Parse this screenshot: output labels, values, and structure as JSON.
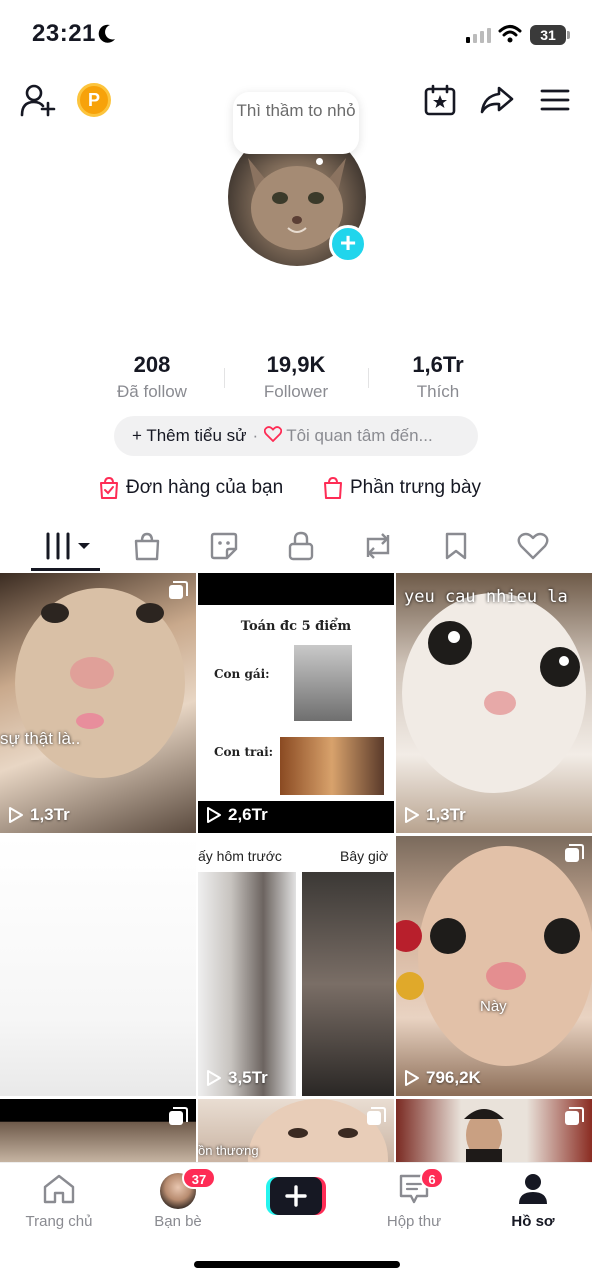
{
  "status_bar": {
    "time": "23:21",
    "battery": "31"
  },
  "header": {
    "coin_letter": "P"
  },
  "profile": {
    "note_bubble": "Thì thầm to nhỏ",
    "stats": [
      {
        "value": "208",
        "label": "Đã follow"
      },
      {
        "value": "19,9K",
        "label": "Follower"
      },
      {
        "value": "1,6Tr",
        "label": "Thích"
      }
    ],
    "bio": {
      "add_label": "+ Thêm tiểu sử",
      "separator": "·",
      "interest_label": "Tôi quan tâm đến..."
    },
    "links": {
      "orders": "Đơn hàng của bạn",
      "showcase": "Phần trưng bày"
    }
  },
  "tabs": [
    "videos-grid",
    "shop",
    "sticker",
    "private",
    "repost",
    "favorites",
    "liked"
  ],
  "grid": [
    {
      "views": "1,3Tr",
      "caption": "sự thật là..",
      "multi": true
    },
    {
      "views": "2,6Tr",
      "caption_title": "Toán đc 5 điểm",
      "label_a": "Con gái:",
      "label_b": "Con trai:",
      "multi": false
    },
    {
      "views": "1,3Tr",
      "caption": "yeu cau nhieu la",
      "multi": false
    },
    {
      "views": "",
      "caption": "",
      "multi": false
    },
    {
      "views": "3,5Tr",
      "caption_left": "ấy hôm trước",
      "caption_right": "Bây giờ",
      "multi": false
    },
    {
      "views": "796,2K",
      "caption": "Này",
      "multi": true
    },
    {
      "views": "",
      "caption": "",
      "multi": true
    },
    {
      "views": "",
      "caption": "ồn thương",
      "multi": true
    },
    {
      "views": "",
      "caption": "",
      "multi": true
    }
  ],
  "bottom_nav": [
    {
      "label": "Trang chủ"
    },
    {
      "label": "Bạn bè",
      "badge": "37"
    },
    {
      "label": ""
    },
    {
      "label": "Hộp thư",
      "badge": "6"
    },
    {
      "label": "Hồ sơ"
    }
  ],
  "colors": {
    "accent": "#fe2c55",
    "cyan": "#20d5ec",
    "text": "#161823",
    "muted": "#8a8b91"
  }
}
